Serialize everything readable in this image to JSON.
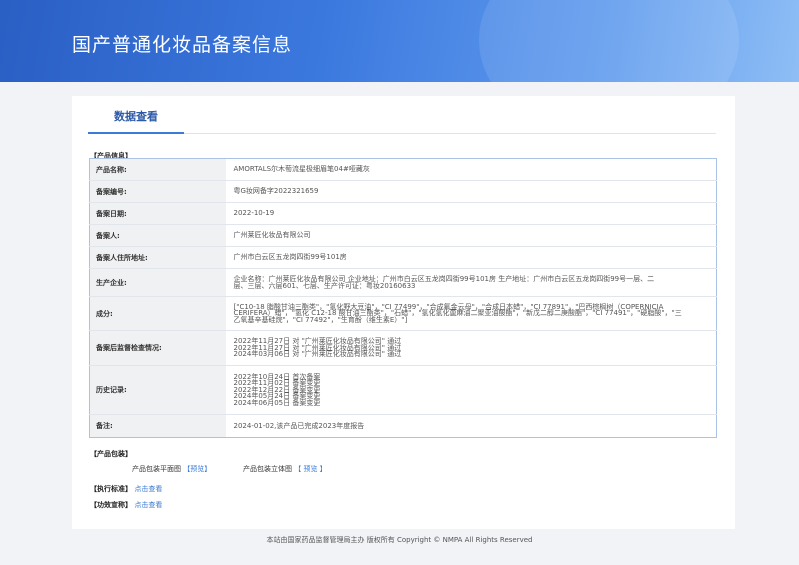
{
  "banner": {
    "title": "国产普通化妆品备案信息"
  },
  "tabs": [
    {
      "label": "数据查看"
    }
  ],
  "product_section": {
    "heading": "【产品信息】",
    "rows": [
      {
        "label": "产品名称:",
        "lines": [
          "AMORTALS尔木萄流星极细眉笔04#哑藏灰"
        ]
      },
      {
        "label": "备案编号:",
        "lines": [
          "粤G妆网备字2022321659"
        ]
      },
      {
        "label": "备案日期:",
        "lines": [
          "2022-10-19"
        ]
      },
      {
        "label": "备案人:",
        "lines": [
          "广州莱匠化妆品有限公司"
        ]
      },
      {
        "label": "备案人住所地址:",
        "lines": [
          "广州市白云区五龙岗四街99号101房"
        ]
      },
      {
        "label": "生产企业:",
        "lines": [
          "企业名称：广州莱匠化妆品有限公司 企业地址：广州市白云区五龙岗四街99号101房 生产地址：广州市白云区五龙岗四街99号一层、二",
          "层、三层、六层601、七层、生产许可证：粤妆20160633"
        ]
      },
      {
        "label": "成分:",
        "lines": [
          "[\"C10-18 脂酸甘油三酯类\"，\"氢化野大豆油\"，\"CI 77499\"，\"合成氟金云母\"，\"合成日本蜡\"，\"CI 77891\"，\"巴西棕榈树（COPERNICIA",
          "CERIFERA）蜡\"，\"氢化 C12-18 酸甘油三酯类\"，\"石蜡\"，\"氢化氢化蓖麻油二聚亚油酸酯\"，\"新戊二醇二庚酸酯\"，\"CI 77491\"，\"硬脂酸\"，\"三",
          "乙氧基辛基硅烷\"，\"CI 77492\"，\"生育酚（维生素E）\"]"
        ]
      },
      {
        "label": "备案后监督检查情况:",
        "lines": [
          "2022年11月27日 对 \"广州莱匠化妆品有限公司\" 通过",
          "2022年11月27日 对 \"广州莱匠化妆品有限公司\" 通过",
          "2024年03月06日 对 \"广州莱匠化妆品有限公司\" 通过"
        ]
      },
      {
        "label": "历史记录:",
        "lines": [
          "2022年10月24日 首次备案",
          "2022年11月02日 备案变更",
          "2022年12月22日 备案变更",
          "2024年05月24日 备案变更",
          "2024年06月05日 备案变更"
        ]
      },
      {
        "label": "备注:",
        "lines": [
          "2024-01-02,该产品已完成2023年度报告"
        ]
      }
    ]
  },
  "package_section": {
    "heading": "【产品包装】",
    "flat_label": "产品包装平面图",
    "solid_label": "产品包装立体图",
    "preview_label": "【预览】",
    "preview_label_2": "【 预览 】"
  },
  "exec_standard": {
    "heading": "【执行标准】",
    "link": "点击查看"
  },
  "efficacy": {
    "heading": "【功效宣称】",
    "link": "点击查看"
  },
  "footer": {
    "text": "本站由国家药品监督管理局主办 版权所有 Copyright © NMPA All Rights Reserved"
  }
}
